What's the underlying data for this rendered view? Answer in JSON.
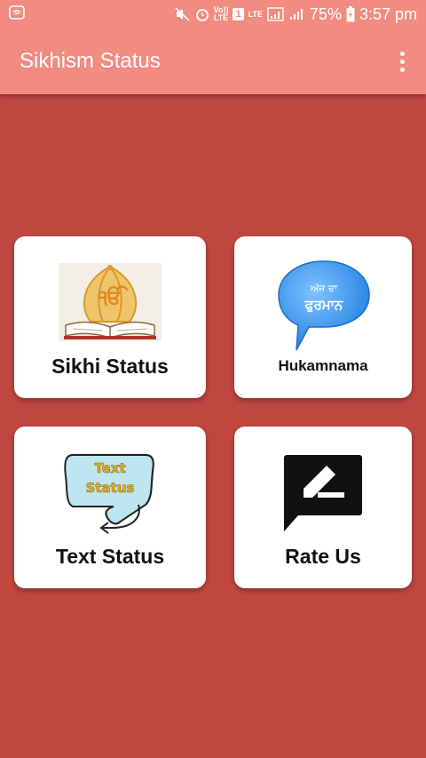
{
  "status_bar": {
    "lte_label": "LTE",
    "volte_top": "Vo))",
    "volte_bottom": "LTE",
    "sim_badge": "1",
    "battery": "75%",
    "time": "3:57 pm"
  },
  "app_bar": {
    "title": "Sikhism Status"
  },
  "cards": {
    "sikhi_status": {
      "label": "Sikhi Status"
    },
    "hukamnama": {
      "label": "Hukamnama",
      "bubble_line1": "ਅੱਜ ਦਾ",
      "bubble_line2": "ਫੁਰਮਾਨ"
    },
    "text_status": {
      "label": "Text Status",
      "bubble_line1": "Text",
      "bubble_line2": "Status"
    },
    "rate_us": {
      "label": "Rate Us"
    }
  },
  "colors": {
    "background": "#c0473f",
    "app_bar": "#f28b80",
    "card": "#ffffff"
  }
}
